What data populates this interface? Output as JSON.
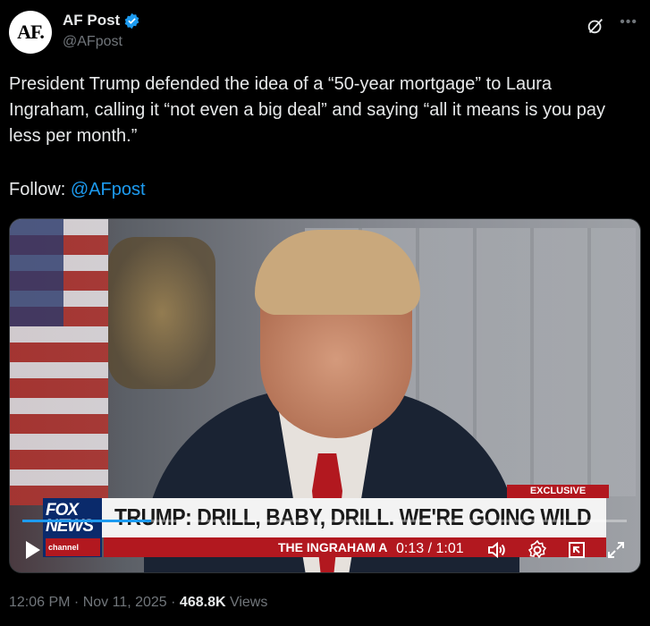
{
  "post": {
    "avatar_text": "AF.",
    "display_name": "AF Post",
    "handle": "@AFpost",
    "body": "President Trump defended the idea of a “50-year mortgage” to Laura Ingraham, calling it “not even a big deal” and saying “all it means is you pay less per month.”",
    "follow_prefix": "Follow: ",
    "follow_link": "@AFpost",
    "timestamp": "12:06 PM · Nov 11, 2025 · ",
    "views_count": "468.8K",
    "views_label": " Views"
  },
  "video": {
    "exclusive_label": "EXCLUSIVE",
    "network_top": "FOX",
    "network_bottom": "NEWS",
    "network_channel": "channel",
    "headline": "TRUMP: DRILL, BABY, DRILL. WE'RE GOING WILD",
    "show_name": "THE INGRAHAM A",
    "time_current": "0:13",
    "time_total": "1:01",
    "time_display": "0:13 / 1:01",
    "progress_fraction": 0.213
  },
  "icons": {
    "verified": "verified-badge-icon",
    "grok": "grok-icon",
    "more": "more-icon",
    "play": "play-icon",
    "volume": "volume-icon",
    "settings": "settings-icon",
    "pip": "pip-icon",
    "fullscreen": "fullscreen-icon"
  },
  "colors": {
    "accent": "#1d9bf0",
    "text": "#e7e9ea",
    "muted": "#71767b",
    "background": "#000000"
  }
}
